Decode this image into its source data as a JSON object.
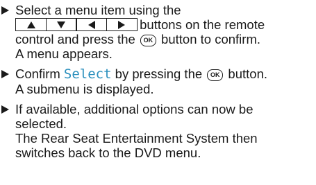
{
  "steps": [
    {
      "line1": "Select a menu item using the",
      "keys": [
        "up-arrow",
        "down-arrow",
        "left-arrow",
        "right-arrow"
      ],
      "line2_after_keys": " buttons on the remote",
      "line3_before_ok": "control and press the ",
      "ok_label": "OK",
      "line3_after_ok": " button to confirm.",
      "line4": "A menu appears."
    },
    {
      "line1_before_highlight": "Confirm ",
      "highlight": "Select",
      "line1_between": " by pressing the ",
      "ok_label": "OK",
      "line1_after_ok": " button.",
      "line2": "A submenu is displayed."
    },
    {
      "line1": "If available, additional options can now be",
      "line2": "selected.",
      "line3": "The Rear Seat Entertainment System then",
      "line4": "switches back to the DVD menu."
    }
  ],
  "colors": {
    "text": "#1a1a1a",
    "highlight": "#2a8fbd"
  }
}
